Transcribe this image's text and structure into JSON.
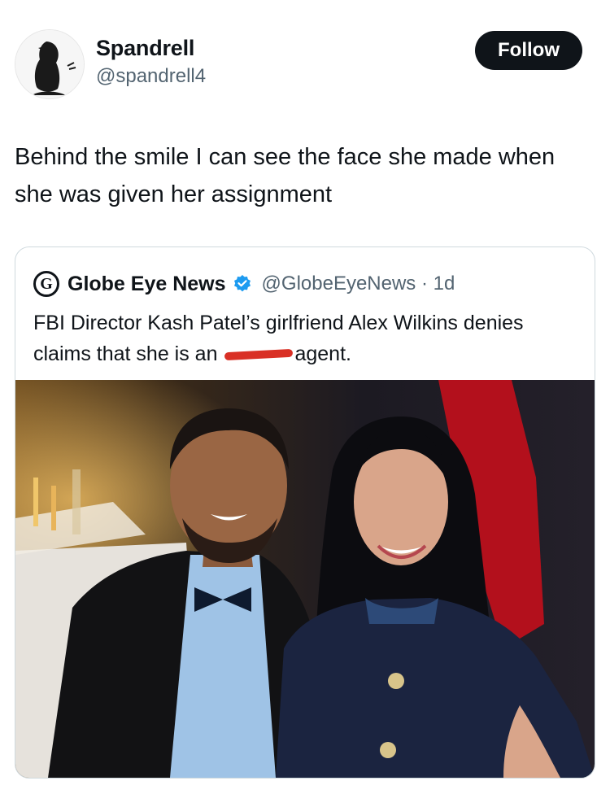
{
  "post": {
    "author_name": "Spandrell",
    "author_handle": "@spandrell4",
    "follow_label": "Follow",
    "text": "Behind the smile I can see the face she made when she was given her assignment"
  },
  "quoted": {
    "logo_letter": "G",
    "name": "Globe Eye News",
    "handle_time": "@GlobeEyeNews · 1d",
    "text_before": "FBI Director Kash Patel’s girlfriend Alex Wilkins denies claims that she is an",
    "text_after": "agent."
  },
  "icons": {
    "avatar": "crow-icon",
    "verified": "verified-badge-icon",
    "redaction": "red-scribble"
  },
  "colors": {
    "follow_bg": "#0f1419",
    "verified_blue": "#1d9bf0",
    "secondary_text": "#536471",
    "redaction": "#d93025"
  }
}
